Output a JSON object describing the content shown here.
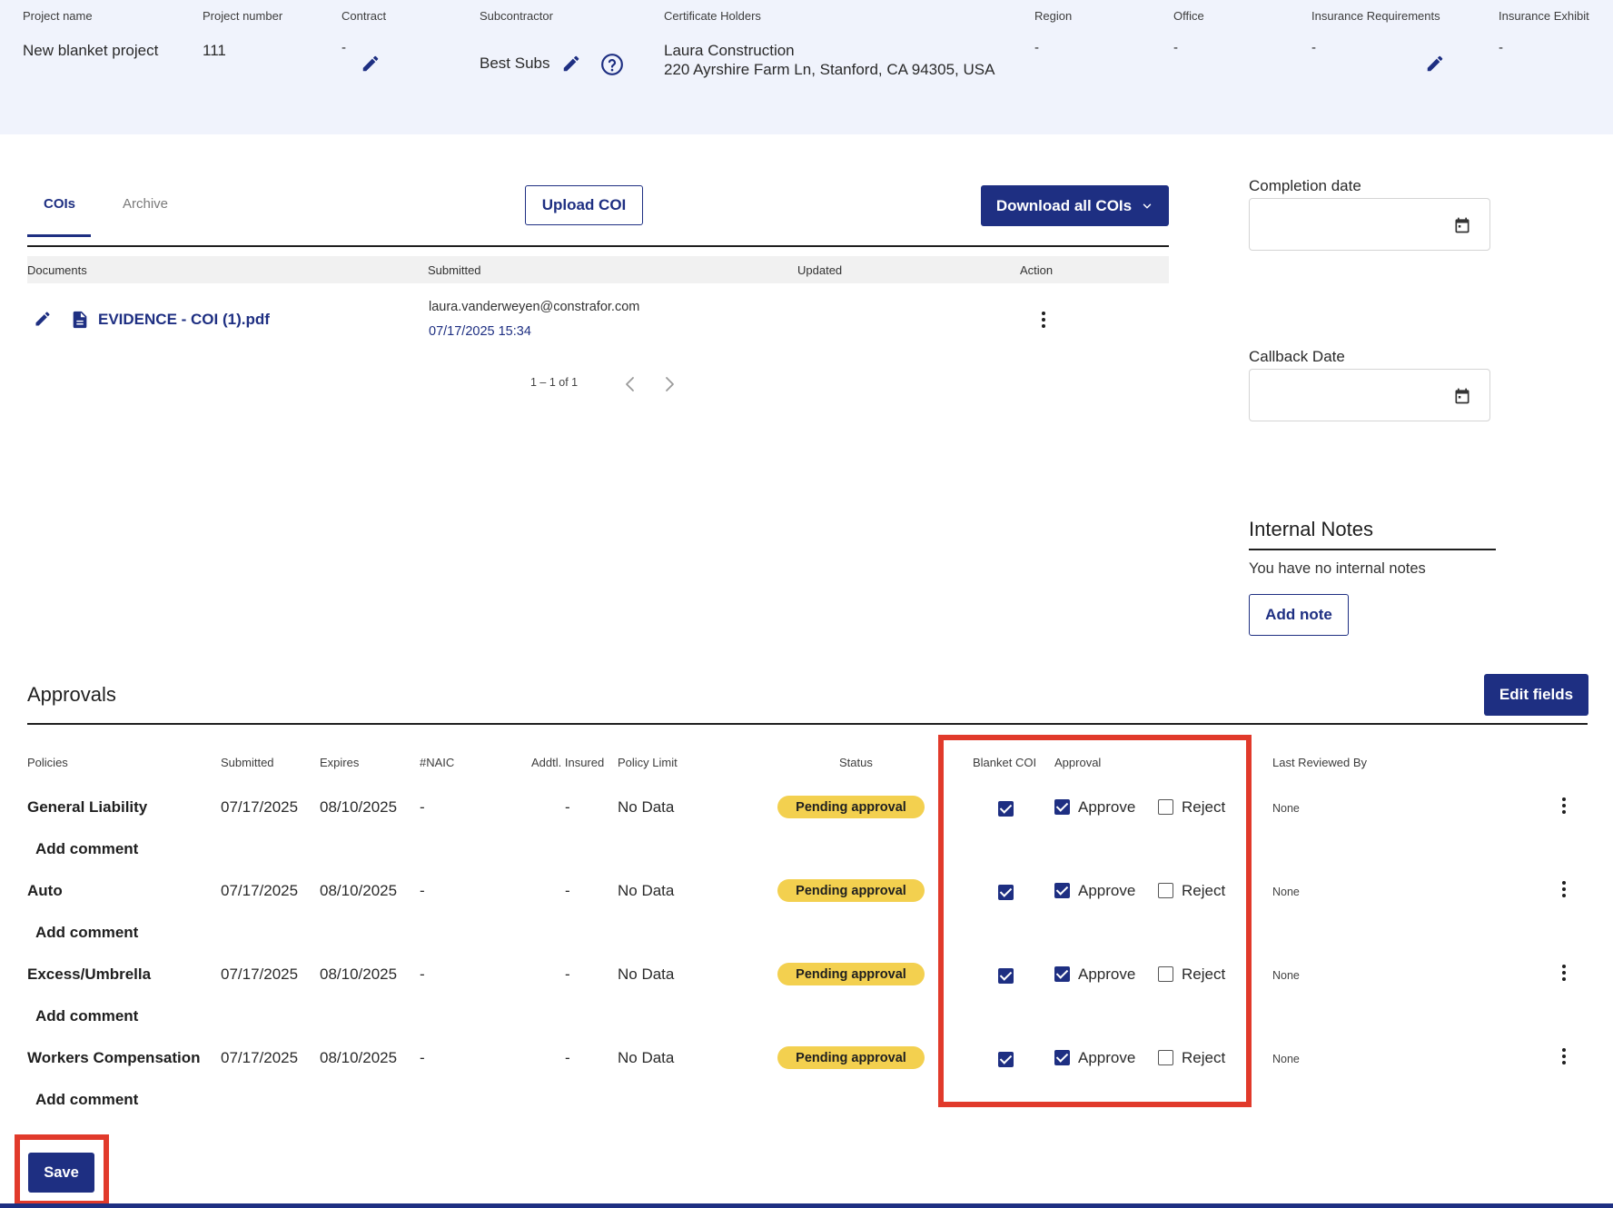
{
  "header": {
    "project_name_label": "Project name",
    "project_name": "New blanket project",
    "project_number_label": "Project number",
    "project_number": "111",
    "contract_label": "Contract",
    "contract": "-",
    "subcontractor_label": "Subcontractor",
    "subcontractor": "Best Subs",
    "certificate_holders_label": "Certificate Holders",
    "certificate_holder_name": "Laura Construction",
    "certificate_holder_address": "220 Ayrshire Farm Ln, Stanford, CA 94305, USA",
    "region_label": "Region",
    "region": "-",
    "office_label": "Office",
    "office": "-",
    "insurance_requirements_label": "Insurance Requirements",
    "insurance_requirements": "-",
    "insurance_exhibit_label": "Insurance Exhibit",
    "insurance_exhibit": "-"
  },
  "tabs": {
    "cois": "COIs",
    "archive": "Archive"
  },
  "toolbar": {
    "upload_coi": "Upload COI",
    "download_all": "Download all COIs"
  },
  "documents": {
    "columns": [
      "Documents",
      "Submitted",
      "Updated",
      "Action"
    ],
    "row": {
      "file_name": "EVIDENCE - COI (1).pdf",
      "submitted_by": "laura.vanderweyen@constrafor.com",
      "submitted_at": "07/17/2025 15:34"
    },
    "pagination": "1 – 1 of 1"
  },
  "side_panel": {
    "completion_date_label": "Completion date",
    "callback_date_label": "Callback Date",
    "internal_notes_title": "Internal Notes",
    "internal_notes_empty": "You have no internal notes",
    "add_note": "Add note"
  },
  "approvals": {
    "title": "Approvals",
    "edit_fields": "Edit fields",
    "columns": {
      "policies": "Policies",
      "submitted": "Submitted",
      "expires": "Expires",
      "naic": "#NAIC",
      "addtl_insured": "Addtl. Insured",
      "policy_limit": "Policy Limit",
      "status": "Status",
      "blanket_coi": "Blanket COI",
      "approval": "Approval",
      "last_reviewed_by": "Last Reviewed By"
    },
    "approve_label": "Approve",
    "reject_label": "Reject",
    "add_comment": "Add comment",
    "rows": [
      {
        "policy": "General Liability",
        "submitted": "07/17/2025",
        "expires": "08/10/2025",
        "naic": "-",
        "addtl_insured": "-",
        "policy_limit": "No Data",
        "status": "Pending approval",
        "blanket_coi": true,
        "approve": true,
        "reject": false,
        "last_reviewed_by": "None"
      },
      {
        "policy": "Auto",
        "submitted": "07/17/2025",
        "expires": "08/10/2025",
        "naic": "-",
        "addtl_insured": "-",
        "policy_limit": "No Data",
        "status": "Pending approval",
        "blanket_coi": true,
        "approve": true,
        "reject": false,
        "last_reviewed_by": "None"
      },
      {
        "policy": "Excess/Umbrella",
        "submitted": "07/17/2025",
        "expires": "08/10/2025",
        "naic": "-",
        "addtl_insured": "-",
        "policy_limit": "No Data",
        "status": "Pending approval",
        "blanket_coi": true,
        "approve": true,
        "reject": false,
        "last_reviewed_by": "None"
      },
      {
        "policy": "Workers Compensation",
        "submitted": "07/17/2025",
        "expires": "08/10/2025",
        "naic": "-",
        "addtl_insured": "-",
        "policy_limit": "No Data",
        "status": "Pending approval",
        "blanket_coi": true,
        "approve": true,
        "reject": false,
        "last_reviewed_by": "None"
      }
    ],
    "save": "Save"
  },
  "colors": {
    "primary": "#1e2f82",
    "header_bg": "#f0f3fc",
    "status_badge": "#f3d04f",
    "highlight": "#e13a2b"
  }
}
